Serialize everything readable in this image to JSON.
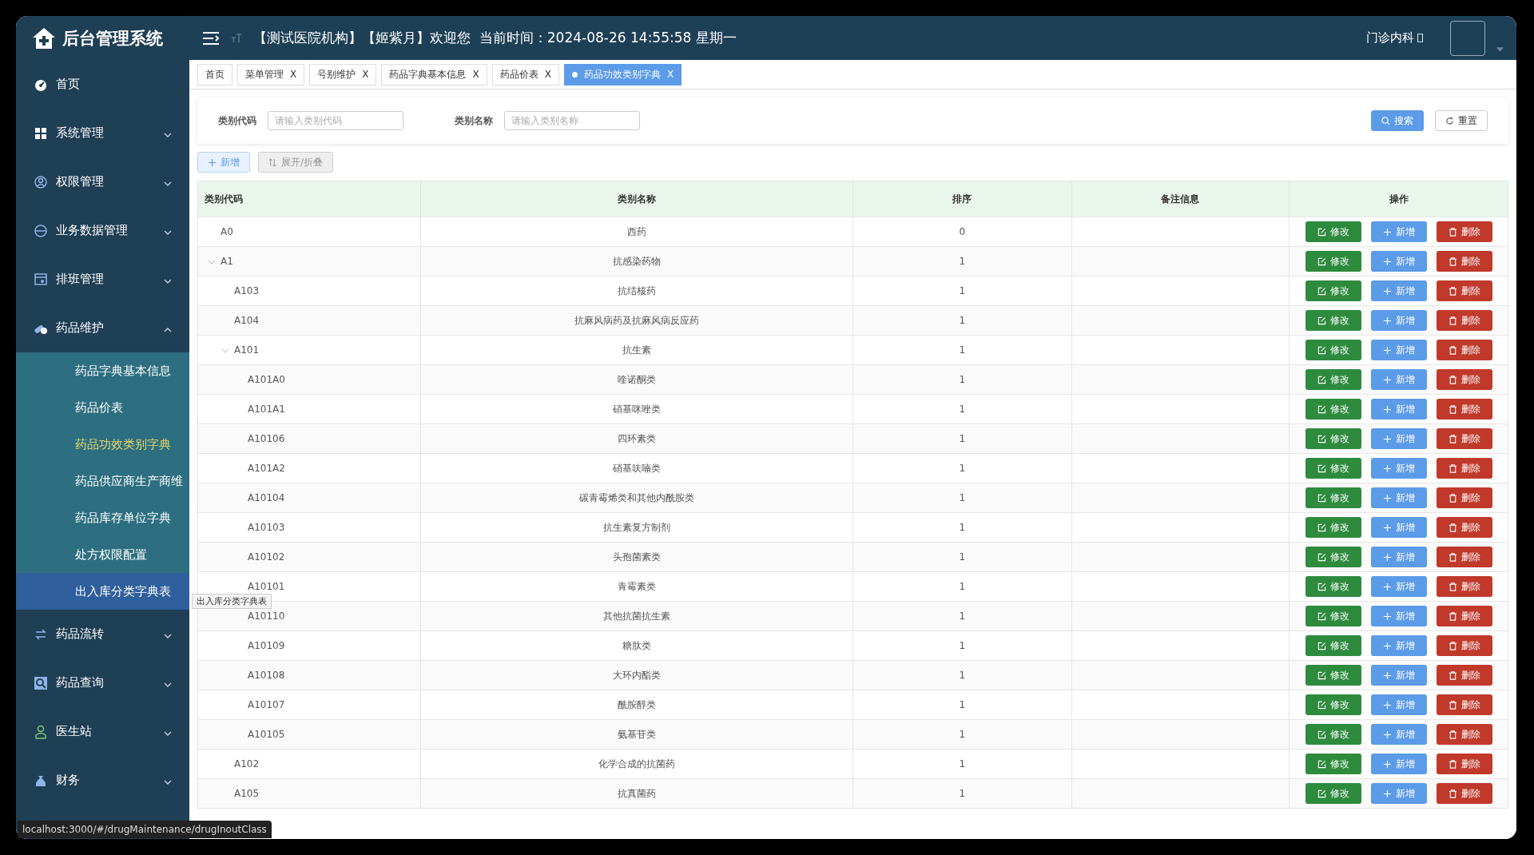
{
  "sidebar": {
    "title": "后台管理系统",
    "menu": [
      {
        "label": "首页"
      },
      {
        "label": "系统管理",
        "expanded": false
      },
      {
        "label": "权限管理",
        "expanded": false
      },
      {
        "label": "业务数据管理",
        "expanded": false
      },
      {
        "label": "排班管理",
        "expanded": false
      },
      {
        "label": "药品维护",
        "expanded": true,
        "children": [
          {
            "label": "药品字典基本信息",
            "selected": false,
            "hovered": false
          },
          {
            "label": "药品价表",
            "selected": false,
            "hovered": false
          },
          {
            "label": "药品功效类别字典",
            "selected": true,
            "hovered": false
          },
          {
            "label": "药品供应商生产商维",
            "selected": false,
            "hovered": false
          },
          {
            "label": "药品库存单位字典",
            "selected": false,
            "hovered": false
          },
          {
            "label": "处方权限配置",
            "selected": false,
            "hovered": false
          },
          {
            "label": "出入库分类字典表",
            "selected": false,
            "hovered": true
          }
        ]
      },
      {
        "label": "药品流转",
        "expanded": false
      },
      {
        "label": "药品查询",
        "expanded": false
      },
      {
        "label": "医生站",
        "expanded": false
      },
      {
        "label": "财务",
        "expanded": false
      }
    ]
  },
  "header": {
    "welcome": "【测试医院机构】【姬紫月】欢迎您  当前时间：2024-08-26 14:55:58 星期一",
    "department": "门诊内科"
  },
  "tabs": [
    {
      "label": "首页",
      "selected": false
    },
    {
      "label": "菜单管理",
      "close": "X",
      "selected": false
    },
    {
      "label": "号别维护",
      "close": "X",
      "selected": false
    },
    {
      "label": "药品字典基本信息",
      "close": "X",
      "selected": false
    },
    {
      "label": "药品价表",
      "close": "X",
      "selected": false
    },
    {
      "label": "药品功效类别字典",
      "close": "X",
      "selected": true
    }
  ],
  "filter": {
    "fields": [
      {
        "label": "类别代码",
        "placeholder": "请输入类别代码"
      },
      {
        "label": "类别名称",
        "placeholder": "请输入类别名称"
      }
    ],
    "search": "搜索",
    "reset": "重置"
  },
  "toolbar": {
    "add": "新增",
    "toggle": "展开/折叠"
  },
  "table": {
    "columns": [
      "类别代码",
      "类别名称",
      "排序",
      "备注信息",
      "操作"
    ],
    "rows": [
      {
        "code": "A0",
        "name": "西药",
        "sort": "0",
        "actions": [
          "修改",
          "新增",
          "删除"
        ]
      },
      {
        "code": "A1",
        "name": "抗感染药物",
        "sort": "1",
        "actions": [
          "修改",
          "新增",
          "删除"
        ],
        "expanded": true,
        "children": [
          {
            "code": "A103",
            "name": "抗结核药",
            "sort": "1",
            "actions": [
              "修改",
              "新增",
              "删除"
            ]
          },
          {
            "code": "A104",
            "name": "抗麻风病药及抗麻风病反应药",
            "sort": "1",
            "actions": [
              "修改",
              "新增",
              "删除"
            ]
          },
          {
            "code": "A101",
            "name": "抗生素",
            "sort": "1",
            "actions": [
              "修改",
              "新增",
              "删除"
            ],
            "expanded": true,
            "children": [
              {
                "code": "A101A0",
                "name": "喹诺酮类",
                "sort": "1",
                "actions": [
                  "修改",
                  "新增",
                  "删除"
                ]
              },
              {
                "code": "A101A1",
                "name": "硝基咪唑类",
                "sort": "1",
                "actions": [
                  "修改",
                  "新增",
                  "删除"
                ]
              },
              {
                "code": "A10106",
                "name": "四环素类",
                "sort": "1",
                "actions": [
                  "修改",
                  "新增",
                  "删除"
                ]
              },
              {
                "code": "A101A2",
                "name": "硝基呋喃类",
                "sort": "1",
                "actions": [
                  "修改",
                  "新增",
                  "删除"
                ]
              },
              {
                "code": "A10104",
                "name": "碳青霉烯类和其他内酰胺类",
                "sort": "1",
                "actions": [
                  "修改",
                  "新增",
                  "删除"
                ]
              },
              {
                "code": "A10103",
                "name": "抗生素复方制剂",
                "sort": "1",
                "actions": [
                  "修改",
                  "新增",
                  "删除"
                ]
              },
              {
                "code": "A10102",
                "name": "头孢菌素类",
                "sort": "1",
                "actions": [
                  "修改",
                  "新增",
                  "删除"
                ]
              },
              {
                "code": "A10101",
                "name": "青霉素类",
                "sort": "1",
                "actions": [
                  "修改",
                  "新增",
                  "删除"
                ]
              },
              {
                "code": "A10110",
                "name": "其他抗菌抗生素",
                "sort": "1",
                "actions": [
                  "修改",
                  "新增",
                  "删除"
                ]
              },
              {
                "code": "A10109",
                "name": "糖肽类",
                "sort": "1",
                "actions": [
                  "修改",
                  "新增",
                  "删除"
                ]
              },
              {
                "code": "A10108",
                "name": "大环内酯类",
                "sort": "1",
                "actions": [
                  "修改",
                  "新增",
                  "删除"
                ]
              },
              {
                "code": "A10107",
                "name": "酰胺醇类",
                "sort": "1",
                "actions": [
                  "修改",
                  "新增",
                  "删除"
                ]
              },
              {
                "code": "A10105",
                "name": "氨基苷类",
                "sort": "1",
                "actions": [
                  "修改",
                  "新增",
                  "删除"
                ]
              }
            ]
          },
          {
            "code": "A102",
            "name": "化学合成的抗菌药",
            "sort": "1",
            "actions": [
              "修改",
              "新增",
              "删除"
            ]
          },
          {
            "code": "A105",
            "name": "抗真菌药",
            "sort": "1",
            "actions": [
              "修改",
              "新增",
              "删除"
            ]
          }
        ]
      }
    ]
  },
  "tooltip": "出入库分类字典表",
  "status_url": "localhost:3000/#/drugMaintenance/drugInoutClass"
}
